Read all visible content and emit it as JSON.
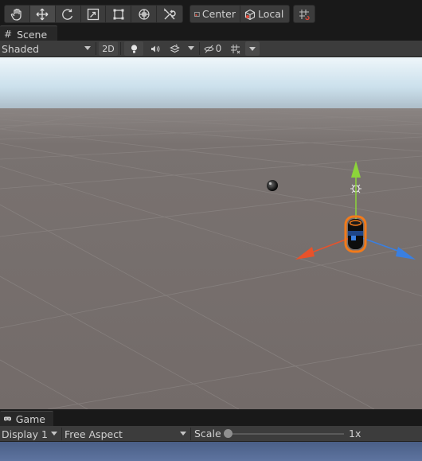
{
  "toolbar": {
    "tools": [
      {
        "name": "hand-tool"
      },
      {
        "name": "move-tool",
        "active": true
      },
      {
        "name": "rotate-tool"
      },
      {
        "name": "scale-tool"
      },
      {
        "name": "rect-tool"
      },
      {
        "name": "transform-tool"
      },
      {
        "name": "custom-tool"
      }
    ],
    "pivot_mode": "Center",
    "pivot_rotation": "Local",
    "snap_icon": "grid-snap-icon"
  },
  "scene_tab": {
    "icon": "hash-icon",
    "label": "Scene"
  },
  "scene_toolbar": {
    "draw_mode": "Shaded",
    "two_d_label": "2D",
    "hidden_count": "0",
    "icons": [
      "light-icon",
      "audio-icon",
      "effects-icon",
      "hidden-objects-icon",
      "grid-icon"
    ]
  },
  "scene": {
    "sky_top": "#dfeef6",
    "ground": "#756d6a",
    "gizmo_colors": {
      "x": "#e8522a",
      "y": "#8cd43a",
      "z": "#3a7fe0",
      "selection": "#f27a1a"
    }
  },
  "game_tab": {
    "icon": "gamepad-icon",
    "label": "Game"
  },
  "game_toolbar": {
    "display": "Display 1",
    "aspect": "Free Aspect",
    "scale_label": "Scale",
    "scale_value": "1x",
    "scale_fraction": 0.0
  }
}
